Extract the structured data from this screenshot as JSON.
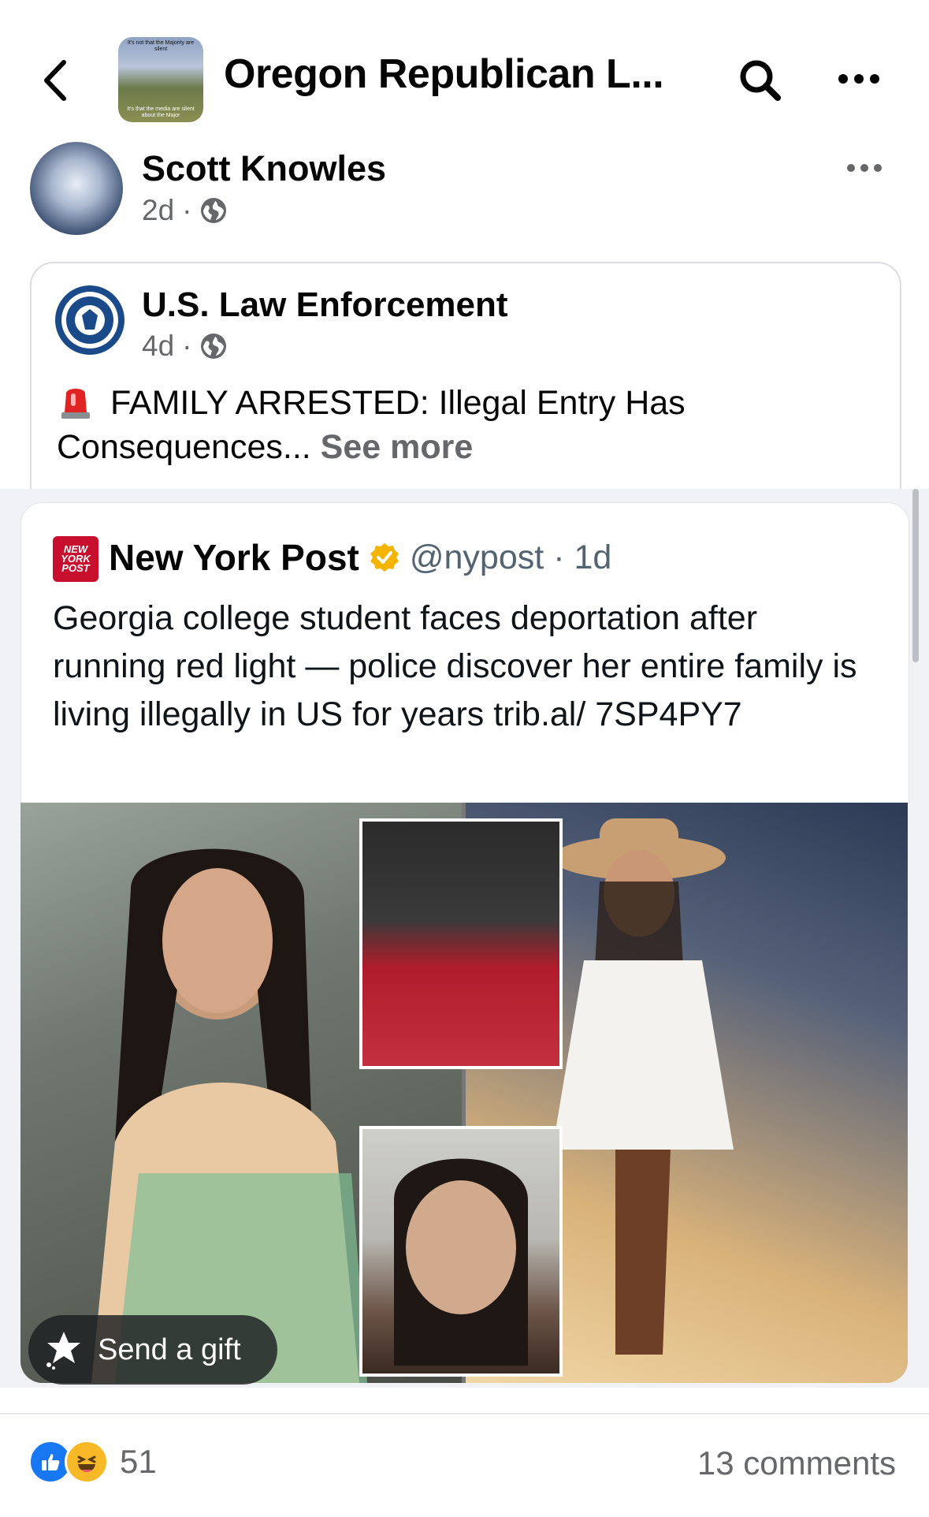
{
  "header": {
    "group_title": "Oregon Republican L...",
    "group_thumb_caption_top": "It's not that the Majority are silent",
    "group_thumb_caption_bottom": "It's that the media are silent about the Major"
  },
  "post": {
    "author": "Scott Knowles",
    "time": "2d",
    "separator": "·",
    "shared": {
      "author": "U.S. Law Enforcement",
      "time": "4d",
      "text": "FAMILY ARRESTED: Illegal Entry Has Consequences...",
      "see_more": "See more"
    }
  },
  "tweet": {
    "logo_text": "NEW YORK POST",
    "name": "New York Post",
    "handle": "@nypost",
    "time": "· 1d",
    "body": "Georgia college student faces deportation after running red light — police discover her entire family is living illegally in US for years trib.al/ 7SP4PY7"
  },
  "gift_button": {
    "label": "Send a gift"
  },
  "footer": {
    "reaction_count": "51",
    "comments": "13 comments"
  },
  "icons": [
    "back-chevron-icon",
    "search-icon",
    "more-icon",
    "globe-icon",
    "siren-icon",
    "verified-badge-icon",
    "gift-icon",
    "like-reaction-icon",
    "haha-reaction-icon"
  ],
  "colors": {
    "facebook_blue": "#1877f2",
    "meta_gray": "#65676b",
    "nypost_red": "#c8102e",
    "verified_gold": "#f4b400"
  }
}
